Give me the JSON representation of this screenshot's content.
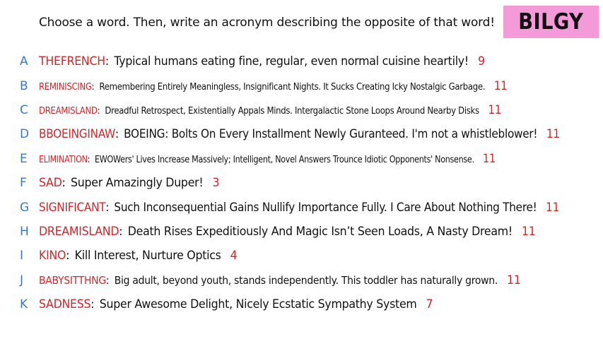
{
  "prompt": "Choose a word. Then, write an acronym describing the opposite of that word!",
  "brand": "BILGY",
  "colors": {
    "letter": "#3d78c8",
    "word": "#d0262b",
    "count": "#d0262b",
    "text": "#111111",
    "brand_bg": "#f59ad8"
  },
  "entries": [
    {
      "letter": "A",
      "word": "THEFRENCH",
      "acronym": "Typical humans eating fine, regular, even normal cuisine heartily!",
      "count": "9"
    },
    {
      "letter": "B",
      "word": "REMINISCING",
      "acronym": "Remembering Entirely Meaningless, Insignificant Nights. It Sucks Creating Icky Nostalgic Garbage.",
      "count": "11"
    },
    {
      "letter": "C",
      "word": "DREAMISLAND",
      "acronym": "Dreadful Retrospect, Existentially Appals Minds. Intergalactic Stone Loops Around Nearby Disks",
      "count": "11"
    },
    {
      "letter": "D",
      "word": "BBOEINGINAW",
      "acronym": "BOEING: Bolts On Every Installment Newly Guranteed. I'm not a whistleblower!",
      "count": "11"
    },
    {
      "letter": "E",
      "word": "ELIMINATION",
      "acronym": "EWOWers' Lives Increase Massively; Intelligent, Novel Answers Trounce Idiotic Opponents' Nonsense.",
      "count": "11"
    },
    {
      "letter": "F",
      "word": "SAD",
      "acronym": "Super Amazingly Duper!",
      "count": "3"
    },
    {
      "letter": "G",
      "word": "SIGNIFICANT",
      "acronym": "Such Inconsequential Gains Nullify Importance Fully. I Care About Nothing There!",
      "count": "11"
    },
    {
      "letter": "H",
      "word": "DREAMISLAND",
      "acronym": "Death Rises Expeditiously And Magic Isn’t Seen Loads, A Nasty Dream!",
      "count": "11"
    },
    {
      "letter": "I",
      "word": "KINO",
      "acronym": "Kill Interest, Nurture Optics",
      "count": "4"
    },
    {
      "letter": "J",
      "word": "BABYSITTHNG",
      "acronym": "Big adult, beyond youth, stands independently. This toddler has naturally grown.",
      "count": "11"
    },
    {
      "letter": "K",
      "word": "SADNESS",
      "acronym": "Super Awesome Delight, Nicely Ecstatic Sympathy System",
      "count": "7"
    }
  ]
}
